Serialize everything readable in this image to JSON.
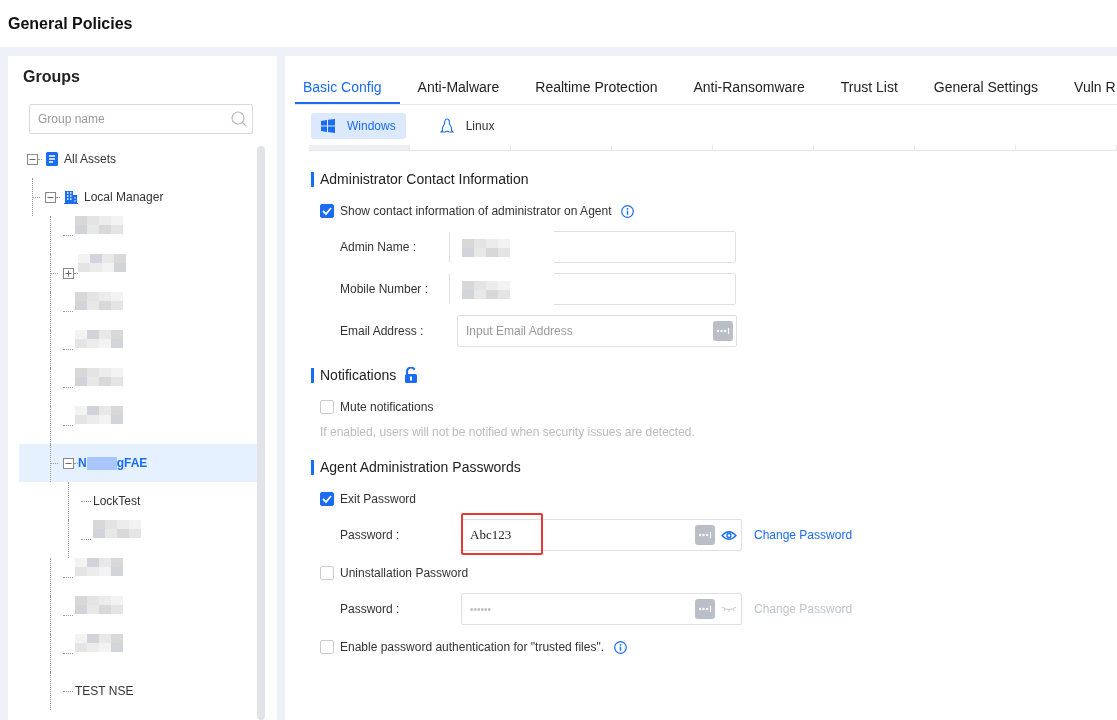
{
  "page": {
    "title": "General Policies"
  },
  "groups": {
    "title": "Groups",
    "search": {
      "placeholder": "Group name"
    },
    "tree": [
      {
        "kind": "root",
        "label": "All Assets",
        "expanded": true,
        "selected": false,
        "children": [
          {
            "kind": "manager",
            "label": "Local Manager",
            "expanded": true,
            "selected": false,
            "children": [
              {
                "kind": "redacted",
                "selected": false
              },
              {
                "kind": "redacted",
                "expanded": false,
                "selected": false
              },
              {
                "kind": "redacted",
                "selected": false
              },
              {
                "kind": "redacted",
                "selected": false
              },
              {
                "kind": "redacted",
                "selected": false
              },
              {
                "kind": "redacted",
                "selected": false
              },
              {
                "kind": "partly_redacted",
                "label_start": "N",
                "label_end": "gFAE",
                "expanded": true,
                "selected": true,
                "children": [
                  {
                    "kind": "group",
                    "label": "LockTest",
                    "selected": false
                  },
                  {
                    "kind": "redacted",
                    "selected": false
                  }
                ]
              },
              {
                "kind": "redacted",
                "selected": false
              },
              {
                "kind": "redacted",
                "selected": false
              },
              {
                "kind": "redacted",
                "selected": false
              },
              {
                "kind": "group",
                "label": "TEST NSE",
                "selected": false
              }
            ]
          }
        ]
      }
    ]
  },
  "tabs": [
    {
      "label": "Basic Config",
      "selected": true
    },
    {
      "label": "Anti-Malware",
      "selected": false
    },
    {
      "label": "Realtime Protection",
      "selected": false
    },
    {
      "label": "Anti-Ransomware",
      "selected": false
    },
    {
      "label": "Trust List",
      "selected": false
    },
    {
      "label": "General Settings",
      "selected": false
    },
    {
      "label": "Vuln R",
      "selected": false
    }
  ],
  "platforms": [
    {
      "kind": "windows",
      "label": "Windows",
      "selected": true
    },
    {
      "kind": "linux",
      "label": "Linux",
      "selected": false
    }
  ],
  "sections": [
    {
      "title": "Administrator Contact Information",
      "items": [
        {
          "kind": "checkbox",
          "label": "Show contact information of administrator on Agent",
          "checked": true,
          "info": true
        },
        {
          "kind": "field",
          "label": "Admin Name :",
          "redacted": true
        },
        {
          "kind": "field",
          "label": "Mobile Number :",
          "redacted": true
        },
        {
          "kind": "field",
          "label": "Email Address :",
          "placeholder": "Input Email Address"
        }
      ]
    },
    {
      "title": "Notifications",
      "unlocked": true,
      "items": [
        {
          "kind": "checkbox",
          "label": "Mute notifications",
          "checked": false
        },
        {
          "kind": "hint",
          "text": "If enabled, users will not be notified when security issues are detected."
        }
      ]
    },
    {
      "title": "Agent Administration Passwords",
      "items": [
        {
          "kind": "checkbox",
          "label": "Exit Password",
          "checked": true
        },
        {
          "kind": "password",
          "label": "Password :",
          "value": "Abc123",
          "masked": false,
          "disabled": false,
          "highlighted": true,
          "link": "Change Password"
        },
        {
          "kind": "checkbox",
          "label": "Uninstallation Password",
          "checked": false
        },
        {
          "kind": "password",
          "label": "Password :",
          "value": "••••••",
          "masked": true,
          "disabled": true,
          "link": "Change Password"
        },
        {
          "kind": "checkbox",
          "label": "Enable password authentication for \"trusted files\".",
          "checked": false,
          "info": true
        }
      ]
    }
  ]
}
